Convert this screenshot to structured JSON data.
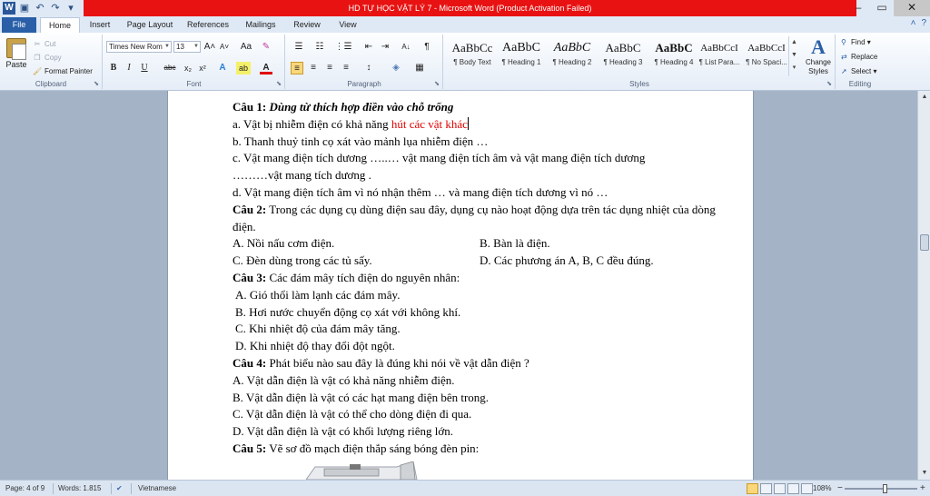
{
  "window": {
    "title": "HD TỰ HỌC VẬT LÝ 7  -  Microsoft Word (Product Activation Failed)",
    "app_icon": "W"
  },
  "quick_access": {
    "icons": [
      "save-icon",
      "undo-icon",
      "redo-icon",
      "customize-icon"
    ],
    "glyphs": [
      "▣",
      "↶",
      "↷",
      "▾"
    ]
  },
  "window_controls": {
    "minimize": "–",
    "maximize": "▭",
    "close": "✕"
  },
  "tabs": [
    "File",
    "Home",
    "Insert",
    "Page Layout",
    "References",
    "Mailings",
    "Review",
    "View"
  ],
  "help": {
    "minimize_ribbon": "˄",
    "help": "?"
  },
  "clipboard": {
    "paste_label": "Paste",
    "cut": "Cut",
    "copy": "Copy",
    "format_painter": "Format Painter",
    "group_label": "Clipboard"
  },
  "font": {
    "name": "Times New Rom",
    "size": "13",
    "grow": "A˄",
    "shrink": "A˅",
    "case": "Aa",
    "clear": "✎",
    "bold": "B",
    "italic": "I",
    "underline": "U",
    "strike": "abc",
    "subscript": "x₂",
    "superscript": "x²",
    "effects": "A",
    "highlight": "ab",
    "font_color": "A",
    "group_label": "Font"
  },
  "paragraph": {
    "bullets": "☰",
    "numbering": "☷",
    "multilevel": "⋮☰",
    "decrease_indent": "⇤",
    "increase_indent": "⇥",
    "sort": "A↓",
    "show_marks": "¶",
    "align_left": "≡",
    "center": "≡",
    "align_right": "≡",
    "justify": "≡",
    "line_spacing": "↕",
    "shading": "◈",
    "borders": "▦",
    "group_label": "Paragraph"
  },
  "styles": {
    "items": [
      {
        "preview": "AaBbCc",
        "name": "¶ Body Text"
      },
      {
        "preview": "AaBbC",
        "name": "¶ Heading 1"
      },
      {
        "preview": "AaBbC",
        "name": "¶ Heading 2"
      },
      {
        "preview": "AaBbC",
        "name": "¶ Heading 3"
      },
      {
        "preview": "AaBbC",
        "name": "¶ Heading 4"
      },
      {
        "preview": "AaBbCcI",
        "name": "¶ List Para..."
      },
      {
        "preview": "AaBbCcI",
        "name": "¶ No Spaci..."
      }
    ],
    "change_styles": "Change Styles",
    "change_icon": "A",
    "group_label": "Styles"
  },
  "editing": {
    "find": "Find",
    "replace": "Replace",
    "select": "Select",
    "group_label": "Editing"
  },
  "document": {
    "q1_label": "Câu 1:",
    "q1_text": "Dùng từ thích  hợp điền vào chỗ trống",
    "q1_a_prefix": "a. Vật bị nhiễm điện có khả năng ",
    "q1_a_answer": "hút các vật khác",
    "q1_b": "b. Thanh thuỷ tinh cọ xát vào mảnh lụa nhiễm điện …",
    "q1_c1": "c. Vật mang điện tích dương …..… vật mang điện tích âm và vật mang điện tích dương",
    "q1_c2": "………vật mang  tích dương .",
    "q1_d": "d. Vật mang điện tích âm vì nó nhận thêm … và mang điện tích dương vì nó …",
    "q2_label": "Câu 2:",
    "q2_text": "Trong các dụng cụ dùng điện sau đây, dụng cụ nào hoạt động dựa trên tác dụng nhiệt của dòng điện.",
    "q2_a": "A. Nồi nấu cơm điện.",
    "q2_b": "B. Bàn là điện.",
    "q2_c": "C. Đèn dùng trong các tủ sấy.",
    "q2_d": "D. Các phương án A, B, C đều đúng.",
    "q3_label": "Câu 3:",
    "q3_text": "Các đám mây tích điện do nguyên nhân:",
    "q3_a": "A.  Gió thổi làm lạnh các đám mây.",
    "q3_b": "B.  Hơi nước chuyển động cọ xát với không khí.",
    "q3_c": "C.  Khi nhiệt độ của đám mây tăng.",
    "q3_d": "D.  Khi nhiệt độ thay đổi đột ngột.",
    "q4_label": "Câu 4:",
    "q4_text": "Phát biểu nào sau đây là đúng khi nói về vật dẫn điện ?",
    "q4_a": "A. Vật dẫn điện là vật có khả năng nhiễm điện.",
    "q4_b": "B. Vật dẫn điện là vật có các hạt mang điện bên trong.",
    "q4_c": "C. Vật dẫn điện là vật có thể cho dòng điện đi qua.",
    "q4_d": "D. Vật dẫn điện là vật có khối lượng riêng lớn.",
    "q5_label": "Câu 5:",
    "q5_text": "Vẽ sơ đồ mạch điện thắp sáng bóng đèn pin:"
  },
  "status": {
    "page": "Page: 4 of 9",
    "words": "Words: 1.815",
    "language": "Vietnamese",
    "zoom": "108%",
    "zoom_out": "−",
    "zoom_in": "+"
  },
  "colors": {
    "title_bar_red": "#e81212",
    "answer_red": "#e00000",
    "file_tab": "#2a5fa8",
    "workspace": "#a4b3c6"
  }
}
